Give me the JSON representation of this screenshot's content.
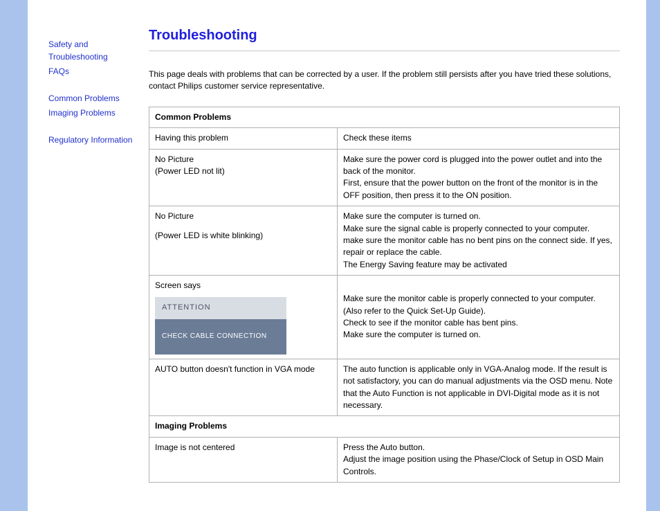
{
  "sidebar": {
    "links": {
      "safety": "Safety and Troubleshooting",
      "faqs": "FAQs",
      "common": "Common Problems",
      "imaging": "Imaging Problems",
      "regulatory": "Regulatory Information"
    }
  },
  "main": {
    "title": "Troubleshooting",
    "intro": "This page deals with problems that can be corrected by a user. If the problem still persists after you have tried these solutions, contact Philips customer service representative.",
    "sections": {
      "common": {
        "heading": "Common Problems",
        "col_problem": "Having this problem",
        "col_check": "Check these items",
        "rows": [
          {
            "problem_line1": "No Picture",
            "problem_line2": "(Power LED not lit)",
            "solution_line1": "Make sure the power cord is plugged into the power outlet and into the back of the monitor.",
            "solution_line2": "First, ensure that the power button on the front of the monitor is in the OFF position, then press it to the ON position."
          },
          {
            "problem_line1": "No Picture",
            "problem_line2": "(Power LED is white blinking)",
            "solution_line1": "Make sure the computer is turned on.",
            "solution_line2": "Make sure the signal cable is properly connected to your computer.",
            "solution_line3": "make sure the monitor cable has no bent pins on the connect side. If yes, repair or replace the cable.",
            "solution_line4": "The Energy Saving feature may be activated"
          },
          {
            "problem_intro": "Screen says",
            "attention_head": "ATTENTION",
            "attention_body": "CHECK CABLE CONNECTION",
            "solution_line1": "Make sure the monitor cable is properly connected to your computer. (Also refer to the Quick Set-Up Guide).",
            "solution_line2": "Check to see if the monitor cable has bent pins.",
            "solution_line3": "Make sure the computer is turned on."
          },
          {
            "problem_line1": "AUTO button doesn't function in VGA mode",
            "solution_line1": "The auto function is applicable only in VGA-Analog mode.  If the result is not satisfactory, you can do manual adjustments via the OSD menu.  Note that the Auto Function is not applicable in DVI-Digital mode as it is not necessary."
          }
        ]
      },
      "imaging": {
        "heading": "Imaging Problems",
        "rows": [
          {
            "problem_line1": "Image is not centered",
            "solution_line1": "Press the Auto button.",
            "solution_line2": "Adjust the image position using the Phase/Clock of Setup in OSD Main Controls."
          }
        ]
      }
    }
  }
}
